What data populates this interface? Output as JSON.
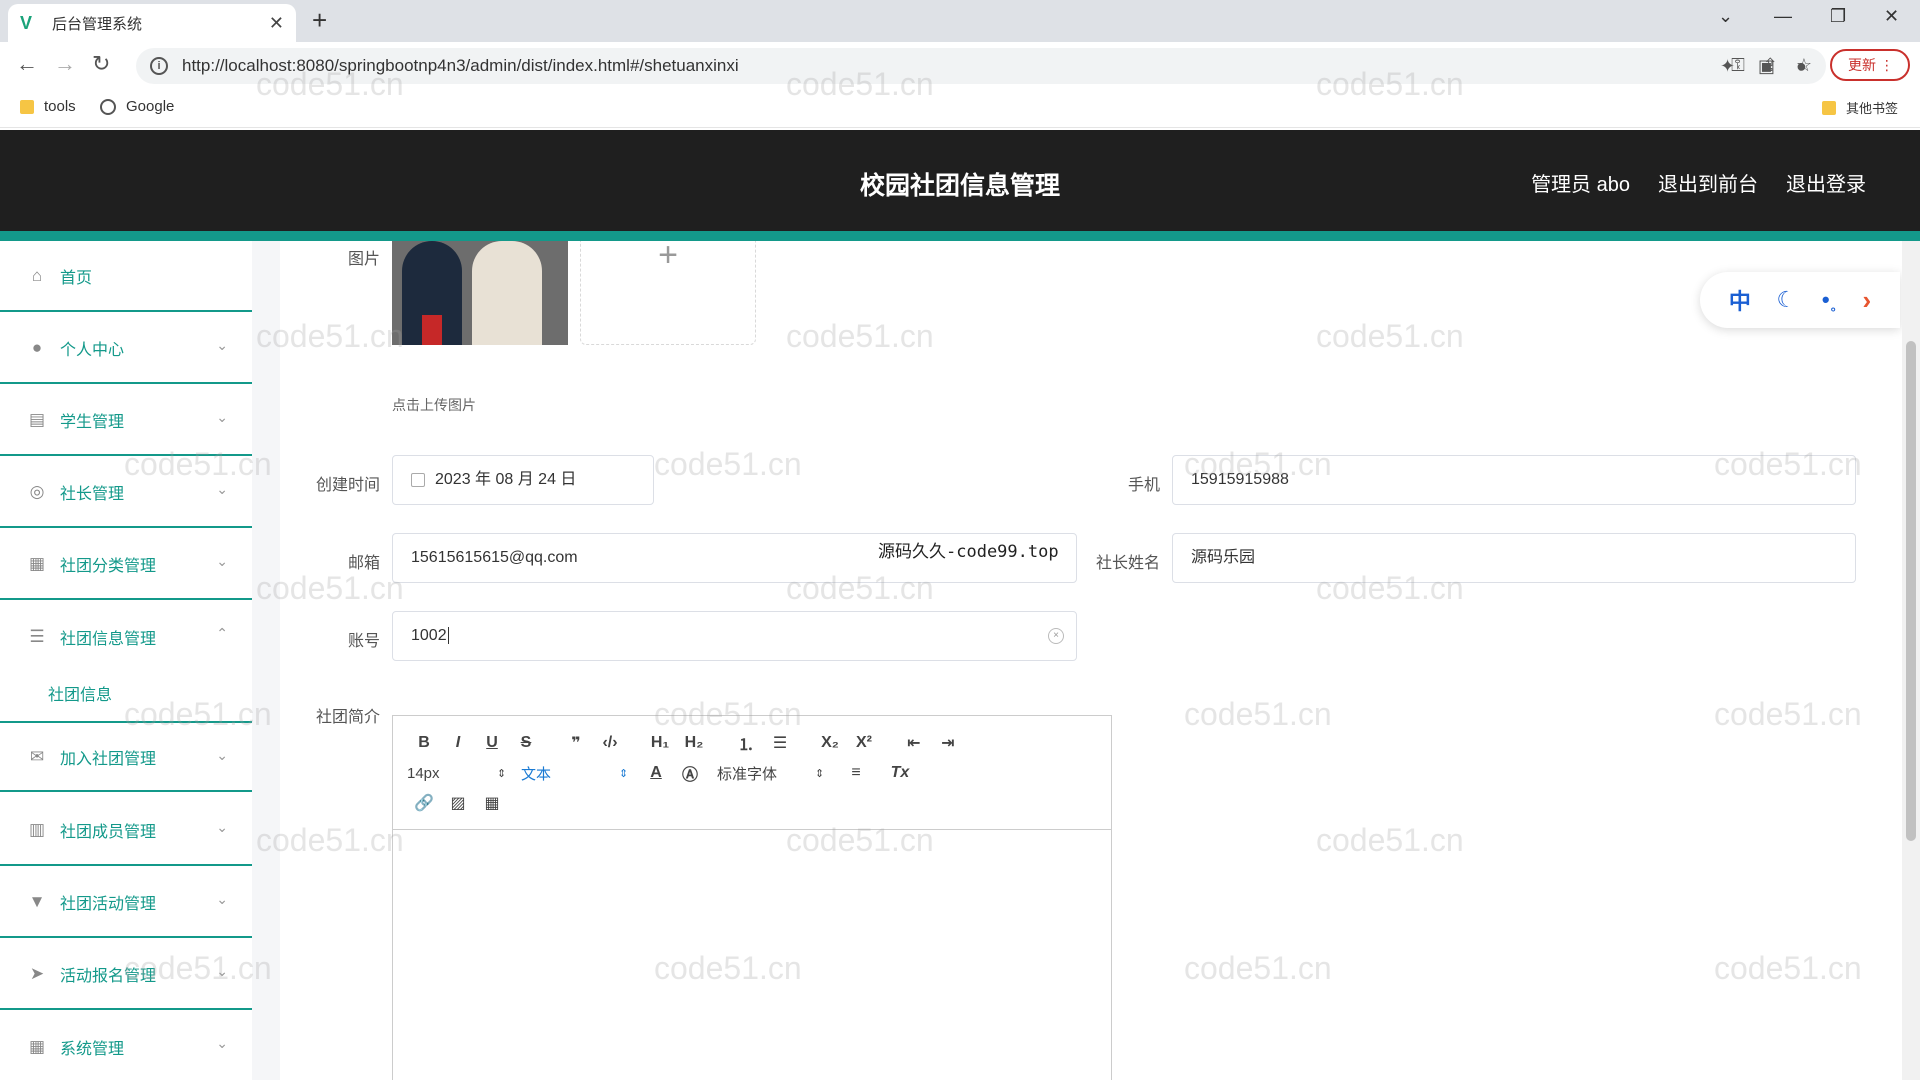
{
  "browser": {
    "tab_title": "后台管理系统",
    "url": "http://localhost:8080/springbootnp4n3/admin/dist/index.html#/shetuanxinxi",
    "update_label": "更新",
    "bookmarks": [
      "tools",
      "Google"
    ],
    "other_bookmarks": "其他书签"
  },
  "header": {
    "title": "校园社团信息管理",
    "user": "管理员 abo",
    "to_front": "退出到前台",
    "logout": "退出登录"
  },
  "sidebar": {
    "items": [
      {
        "label": "首页",
        "icon": "home-icon"
      },
      {
        "label": "个人中心",
        "icon": "user-icon"
      },
      {
        "label": "学生管理",
        "icon": "clipboard-icon"
      },
      {
        "label": "社长管理",
        "icon": "compass-icon"
      },
      {
        "label": "社团分类管理",
        "icon": "printer-icon"
      },
      {
        "label": "社团信息管理",
        "icon": "list-icon"
      },
      {
        "label": "加入社团管理",
        "icon": "mail-icon"
      },
      {
        "label": "社团成员管理",
        "icon": "document-icon"
      },
      {
        "label": "社团活动管理",
        "icon": "podium-icon"
      },
      {
        "label": "活动报名管理",
        "icon": "send-icon"
      },
      {
        "label": "系统管理",
        "icon": "grid-icon"
      }
    ],
    "subitem": "社团信息"
  },
  "form": {
    "image_label": "图片",
    "upload_hint": "点击上传图片",
    "created_label": "创建时间",
    "created_value": "2023 年 08 月 24 日",
    "phone_label": "手机",
    "phone_value": "15915915988",
    "email_label": "邮箱",
    "email_value": "15615615615@qq.com",
    "leader_label": "社长姓名",
    "leader_value": "源码乐园",
    "account_label": "账号",
    "account_value": "1002",
    "intro_label": "社团简介",
    "overlay": "源码久久-code99.top"
  },
  "editor": {
    "font_size": "14px",
    "text_type": "文本",
    "font_family": "标准字体"
  },
  "widget": {
    "lang": "中"
  },
  "watermark": "code51.cn"
}
